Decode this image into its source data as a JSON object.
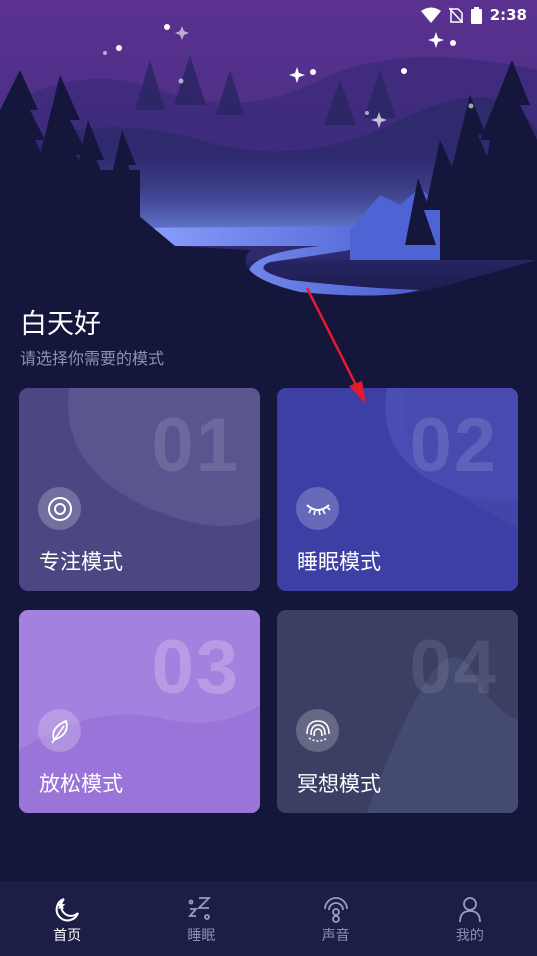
{
  "status_bar": {
    "time": "2:38"
  },
  "greeting": {
    "title": "白天好",
    "subtitle": "请选择你需要的模式"
  },
  "modes": [
    {
      "number": "01",
      "label": "专注模式",
      "icon": "target-icon",
      "color": "#4c4783"
    },
    {
      "number": "02",
      "label": "睡眠模式",
      "icon": "closed-eye-icon",
      "color": "#3d3fa4"
    },
    {
      "number": "03",
      "label": "放松模式",
      "icon": "leaf-icon",
      "color": "#a381de"
    },
    {
      "number": "04",
      "label": "冥想模式",
      "icon": "fingerprint-icon",
      "color": "#3a3f63"
    }
  ],
  "tabs": [
    {
      "label": "首页",
      "icon": "moon-star-icon",
      "active": true
    },
    {
      "label": "睡眠",
      "icon": "sleep-zz-icon",
      "active": false
    },
    {
      "label": "声音",
      "icon": "sound-icon",
      "active": false
    },
    {
      "label": "我的",
      "icon": "person-icon",
      "active": false
    }
  ],
  "colors": {
    "background": "#15163b",
    "tabbar": "#1d1e47",
    "annotation_arrow": "#e8192c"
  }
}
